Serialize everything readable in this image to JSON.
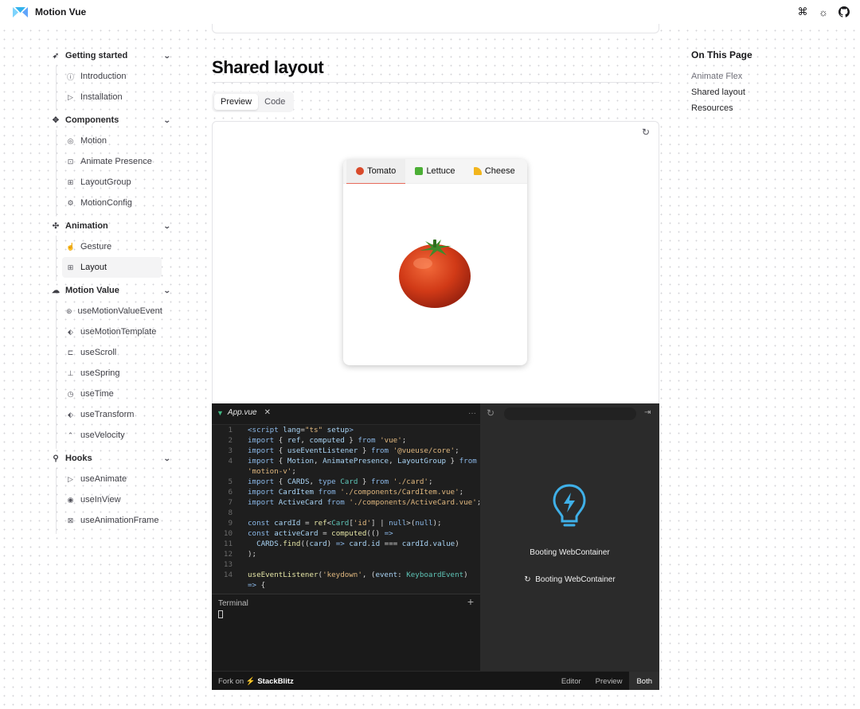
{
  "header": {
    "brand": "Motion Vue",
    "icons": [
      "command-icon",
      "theme-toggle-icon",
      "github-icon"
    ],
    "icon_glyphs": [
      "⌘",
      "☼",
      "◉"
    ]
  },
  "sidebar": {
    "sections": [
      {
        "title": "Getting started",
        "icon": "rocket-icon",
        "glyph": "➶",
        "items": [
          {
            "label": "Introduction",
            "icon": "info-icon",
            "glyph": "ⓘ"
          },
          {
            "label": "Installation",
            "icon": "play-icon",
            "glyph": "▷"
          }
        ]
      },
      {
        "title": "Components",
        "icon": "components-icon",
        "glyph": "✥",
        "items": [
          {
            "label": "Motion",
            "icon": "target-icon",
            "glyph": "◎"
          },
          {
            "label": "Animate Presence",
            "icon": "presence-icon",
            "glyph": "⊡"
          },
          {
            "label": "LayoutGroup",
            "icon": "grid-icon",
            "glyph": "⊞"
          },
          {
            "label": "MotionConfig",
            "icon": "settings-icon",
            "glyph": "⚙"
          }
        ]
      },
      {
        "title": "Animation",
        "icon": "move-icon",
        "glyph": "✣",
        "items": [
          {
            "label": "Gesture",
            "icon": "hand-icon",
            "glyph": "☝"
          },
          {
            "label": "Layout",
            "icon": "layout-icon",
            "glyph": "⊞",
            "active": true
          }
        ]
      },
      {
        "title": "Motion Value",
        "icon": "cloud-icon",
        "glyph": "☁",
        "items": [
          {
            "label": "useMotionValueEvent",
            "icon": "event-icon",
            "glyph": "⊛"
          },
          {
            "label": "useMotionTemplate",
            "icon": "template-icon",
            "glyph": "⬖"
          },
          {
            "label": "useScroll",
            "icon": "scroll-icon",
            "glyph": "⊏"
          },
          {
            "label": "useSpring",
            "icon": "spring-icon",
            "glyph": "⊥"
          },
          {
            "label": "useTime",
            "icon": "clock-icon",
            "glyph": "◷"
          },
          {
            "label": "useTransform",
            "icon": "transform-icon",
            "glyph": "⬖"
          },
          {
            "label": "useVelocity",
            "icon": "chevrons-up-icon",
            "glyph": "⌃"
          }
        ]
      },
      {
        "title": "Hooks",
        "icon": "hook-icon",
        "glyph": "⚲",
        "items": [
          {
            "label": "useAnimate",
            "icon": "play-icon",
            "glyph": "▷"
          },
          {
            "label": "useInView",
            "icon": "eye-icon",
            "glyph": "◉"
          },
          {
            "label": "useAnimationFrame",
            "icon": "frame-icon",
            "glyph": "⊠"
          }
        ]
      }
    ]
  },
  "main": {
    "title": "Shared layout",
    "tabs": [
      "Preview",
      "Code"
    ],
    "active_tab": "Preview",
    "card": {
      "tabs": [
        {
          "label": "Tomato",
          "color": "#d94a2b"
        },
        {
          "label": "Lettuce",
          "color": "#4caf36"
        },
        {
          "label": "Cheese",
          "color": "#f2b51c"
        }
      ],
      "active": "Tomato"
    }
  },
  "editor": {
    "file_tab": "App.vue",
    "code_lines": [
      {
        "n": "1",
        "html": "<span class='kw'>&lt;script</span> <span class='vr'>lang</span>=<span class='st'>\"ts\"</span> <span class='vr'>setup</span><span class='kw'>&gt;</span>"
      },
      {
        "n": "2",
        "html": "<span class='kw'>import</span> { <span class='vr'>ref</span>, <span class='vr'>computed</span> } <span class='kw'>from</span> <span class='st'>'vue'</span>;"
      },
      {
        "n": "3",
        "html": "<span class='kw'>import</span> { <span class='vr'>useEventListener</span> } <span class='kw'>from</span> <span class='st'>'@vueuse/core'</span>;"
      },
      {
        "n": "4",
        "html": "<span class='kw'>import</span> { <span class='vr'>Motion</span>, <span class='vr'>AnimatePresence</span>, <span class='vr'>LayoutGroup</span> } <span class='kw'>from</span>"
      },
      {
        "n": "",
        "html": "<span class='st'>'motion-v'</span>;"
      },
      {
        "n": "5",
        "html": "<span class='kw'>import</span> { <span class='vr'>CARDS</span>, <span class='kw'>type</span> <span class='ty'>Card</span> } <span class='kw'>from</span> <span class='st'>'./card'</span>;"
      },
      {
        "n": "6",
        "html": "<span class='kw'>import</span> <span class='vr'>CardItem</span> <span class='kw'>from</span> <span class='st'>'./components/CardItem.vue'</span>;"
      },
      {
        "n": "7",
        "html": "<span class='kw'>import</span> <span class='vr'>ActiveCard</span> <span class='kw'>from</span> <span class='st'>'./components/ActiveCard.vue'</span>;"
      },
      {
        "n": "8",
        "html": ""
      },
      {
        "n": "9",
        "html": "<span class='kw'>const</span> <span class='vr'>cardId</span> = <span class='fn'>ref</span>&lt;<span class='ty'>Card</span>[<span class='st'>'id'</span>] | <span class='kw'>null</span>&gt;(<span class='kw'>null</span>);"
      },
      {
        "n": "10",
        "html": "<span class='kw'>const</span> <span class='vr'>activeCard</span> = <span class='fn'>computed</span>(() <span class='kw'>=&gt;</span>"
      },
      {
        "n": "11",
        "html": "  <span class='vr'>CARDS</span>.<span class='fn'>find</span>((<span class='vr'>card</span>) <span class='kw'>=&gt;</span> <span class='vr'>card</span>.<span class='vr'>id</span> === <span class='vr'>cardId</span>.<span class='vr'>value</span>)"
      },
      {
        "n": "12",
        "html": ");"
      },
      {
        "n": "13",
        "html": ""
      },
      {
        "n": "14",
        "html": "<span class='fn'>useEventListener</span>(<span class='st'>'keydown'</span>, (<span class='vr'>event</span>: <span class='ty'>KeyboardEvent</span>)"
      },
      {
        "n": "",
        "html": "<span class='kw'>=&gt;</span> {"
      }
    ],
    "terminal_title": "Terminal",
    "booting_title": "Booting WebContainer",
    "booting_status": "Booting WebContainer",
    "fork_prefix": "Fork on",
    "fork_brand": "StackBlitz",
    "views": [
      "Editor",
      "Preview",
      "Both"
    ],
    "active_view": "Both"
  },
  "toc": {
    "title": "On This Page",
    "links": [
      {
        "label": "Animate Flex",
        "muted": true
      },
      {
        "label": "Shared layout",
        "muted": false
      },
      {
        "label": "Resources",
        "muted": false
      }
    ]
  }
}
